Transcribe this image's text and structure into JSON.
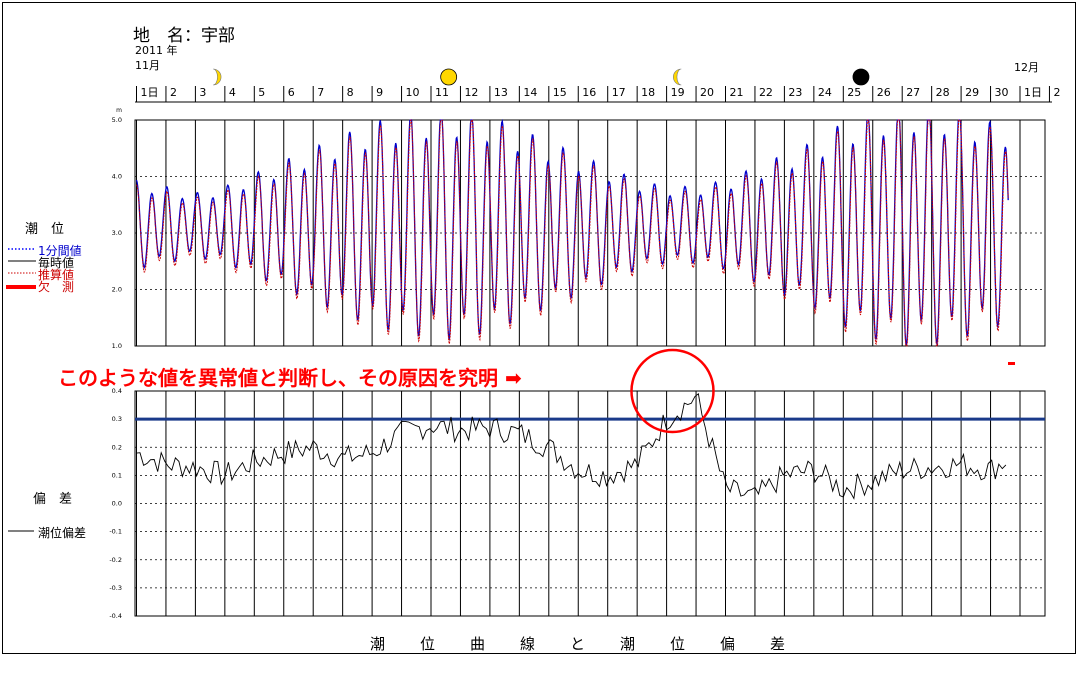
{
  "header": {
    "location_label": "地　名：宇部",
    "year_label": "2011 年",
    "month_label": "11月",
    "next_month_label": "12月"
  },
  "legend": {
    "upper_title": "潮　位",
    "lower_title": "偏　差",
    "items": [
      {
        "label": "1分間値",
        "color": "#0000ff",
        "style": "dotted"
      },
      {
        "label": "毎時値",
        "color": "#000000",
        "style": "solid"
      },
      {
        "label": "推算値",
        "color": "#cc0000",
        "style": "dotted"
      },
      {
        "label": "欠　測",
        "color": "#ff0000",
        "style": "thick"
      }
    ],
    "deviation_item": "潮位偏差"
  },
  "annotation": {
    "text": "このような値を異常値と判断し、その原因を究明 ➡",
    "color": "#ff0000"
  },
  "footer_title": "潮　位　曲　線　と　潮　位　偏　差",
  "chart_data": [
    {
      "type": "line",
      "name": "tide-curve",
      "x": {
        "type": "day",
        "range": [
          1,
          31
        ],
        "tick_labels": [
          "1日",
          "2",
          "3",
          "4",
          "5",
          "6",
          "7",
          "8",
          "9",
          "10",
          "11",
          "12",
          "13",
          "14",
          "15",
          "16",
          "17",
          "18",
          "19",
          "20",
          "21",
          "22",
          "23",
          "24",
          "25",
          "26",
          "27",
          "28",
          "29",
          "30",
          "1日",
          "2"
        ]
      },
      "y_axis_label": "m",
      "ylim": [
        1.0,
        5.0
      ],
      "yticks": [
        "1.0",
        "2.0",
        "3.0",
        "4.0",
        "5.0"
      ],
      "mean_level": 3.1,
      "daily_amplitude": [
        0.7,
        0.6,
        0.5,
        0.6,
        0.8,
        1.0,
        1.2,
        1.4,
        1.6,
        1.7,
        1.8,
        1.8,
        1.7,
        1.5,
        1.3,
        1.1,
        0.9,
        0.7,
        0.6,
        0.6,
        0.7,
        0.9,
        1.1,
        1.3,
        1.6,
        1.8,
        1.9,
        1.9,
        1.8,
        1.6
      ],
      "series": [
        {
          "name": "1分間値",
          "color": "#0000cc"
        },
        {
          "name": "推算値",
          "color": "#cc0000"
        }
      ],
      "moon_phases": [
        {
          "day": 3.6,
          "phase": "first-quarter",
          "color": "#ffd700"
        },
        {
          "day": 11.6,
          "phase": "full",
          "color": "#ffd700"
        },
        {
          "day": 19.5,
          "phase": "last-quarter",
          "color": "#ffd700"
        },
        {
          "day": 25.6,
          "phase": "new",
          "color": "#000000"
        }
      ]
    },
    {
      "type": "line",
      "name": "tide-deviation",
      "ylim": [
        -0.4,
        0.4
      ],
      "yticks": [
        "-0.4",
        "-0.3",
        "-0.2",
        "-0.1",
        "0.0",
        "0.1",
        "0.2",
        "0.3",
        "0.4"
      ],
      "threshold": 0.3,
      "threshold_color": "#1a3a8a",
      "series": [
        {
          "name": "潮位偏差",
          "color": "#000000",
          "daily_values": [
            0.18,
            0.14,
            0.13,
            0.1,
            0.15,
            0.18,
            0.2,
            0.16,
            0.18,
            0.25,
            0.28,
            0.26,
            0.27,
            0.25,
            0.2,
            0.12,
            0.1,
            0.14,
            0.3,
            0.38,
            0.05,
            0.02,
            0.1,
            0.12,
            0.05,
            0.08,
            0.12,
            0.13,
            0.14,
            0.12,
            0.18
          ]
        }
      ]
    }
  ]
}
